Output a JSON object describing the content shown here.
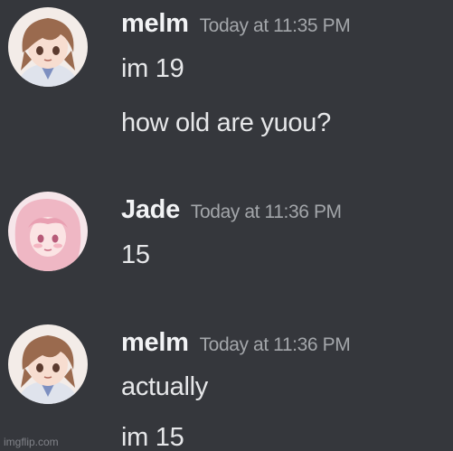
{
  "messages": [
    {
      "username": "melm",
      "timestamp": "Today at 11:35 PM",
      "lines": [
        "im 19",
        "how old are yuou?"
      ],
      "avatar_icon": "anime-brown-hair-avatar-icon"
    },
    {
      "username": "Jade",
      "timestamp": "Today at 11:36 PM",
      "lines": [
        "15"
      ],
      "avatar_icon": "anime-pink-hair-avatar-icon"
    },
    {
      "username": "melm",
      "timestamp": "Today at 11:36 PM",
      "lines": [
        "actually",
        "im 15"
      ],
      "avatar_icon": "anime-brown-hair-avatar-icon"
    }
  ],
  "watermark": "imgflip.com",
  "colors": {
    "background": "#35373c",
    "username": "#f2f3f5",
    "timestamp": "#a3a6aa",
    "message_text": "#e6e7e9"
  }
}
